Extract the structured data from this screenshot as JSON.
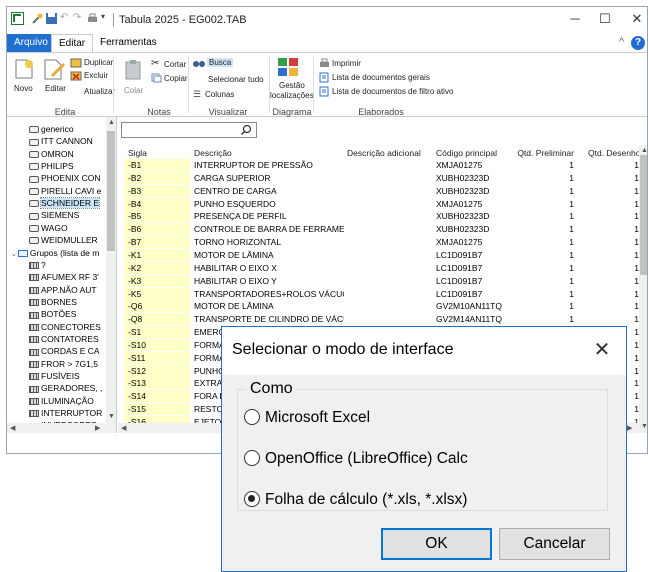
{
  "window": {
    "title": "Tabula 2025 - EG002.TAB",
    "controls": {
      "minimize": "─",
      "maximize": "☐",
      "close": "✕"
    }
  },
  "ribbon_tabs": {
    "file": "Arquivo",
    "edit": "Editar",
    "tools": "Ferramentas",
    "collapse": "^",
    "help": "?"
  },
  "ribbon": {
    "edita": {
      "novo": "Novo",
      "editar": "Editar",
      "duplicar": "Duplicar",
      "excluir": "Excluir",
      "atualizar": "Atualizar",
      "label": "Edita"
    },
    "notas": {
      "colar": "Colar",
      "cortar": "Cortar",
      "copiar": "Copiar",
      "label": "Notas"
    },
    "visualizar": {
      "busca": "Busca",
      "selecionar_tudo": "Selecionar tudo",
      "colunas": "Colunas",
      "label": "Visualizar"
    },
    "diagrama": {
      "gestao": "Gestão",
      "localizacoes": "localizações",
      "label": "Diagrama"
    },
    "elaborados": {
      "imprimir": "Imprimir",
      "lista_geral": "Lista de documentos gerais",
      "lista_filtro": "Lista de documentos de filtro ativo",
      "label": "Elaborados"
    }
  },
  "tree": {
    "items": [
      {
        "label": "generico",
        "kind": "folder"
      },
      {
        "label": "ITT CANNON",
        "kind": "folder"
      },
      {
        "label": "OMRON",
        "kind": "folder"
      },
      {
        "label": "PHILIPS",
        "kind": "folder"
      },
      {
        "label": "PHOENIX CON",
        "kind": "folder"
      },
      {
        "label": "PIRELLI CAVI e",
        "kind": "folder"
      },
      {
        "label": "SCHNEIDER E",
        "kind": "folder",
        "selected": true
      },
      {
        "label": "SIEMENS",
        "kind": "folder"
      },
      {
        "label": "WAGO",
        "kind": "folder"
      },
      {
        "label": "WEIDMULLER",
        "kind": "folder"
      },
      {
        "label": "Grupos (lista de m",
        "kind": "root"
      },
      {
        "label": "?",
        "kind": "group"
      },
      {
        "label": "AFUMEX RF 3'",
        "kind": "group"
      },
      {
        "label": "APP.NÃO AUT",
        "kind": "group"
      },
      {
        "label": "BORNES",
        "kind": "group"
      },
      {
        "label": "BOTÕES",
        "kind": "group"
      },
      {
        "label": "CONECTORES",
        "kind": "group"
      },
      {
        "label": "CONTATORES",
        "kind": "group"
      },
      {
        "label": "CORDAS E CA",
        "kind": "group"
      },
      {
        "label": "FROR > 7G1,5",
        "kind": "group"
      },
      {
        "label": "FUSÍVEIS",
        "kind": "group"
      },
      {
        "label": "GERADORES, ,",
        "kind": "group"
      },
      {
        "label": "ILUMINAÇÃO",
        "kind": "group"
      },
      {
        "label": "INTERRUPTOR",
        "kind": "group"
      },
      {
        "label": "INVERSORES",
        "kind": "group"
      }
    ]
  },
  "grid": {
    "search_placeholder": "",
    "columns": [
      "Sigla",
      "Descrição",
      "Descrição adicional",
      "Código principal",
      "Qtd. Preliminar",
      "Qtd. Desenho"
    ],
    "rows": [
      {
        "sigla": "-B1",
        "desc": "INTERRUPTOR DE PRESSÃO",
        "add": "",
        "code": "XMJA01275",
        "qp": "1",
        "qd": "1"
      },
      {
        "sigla": "-B2",
        "desc": "CARGA SUPERIOR",
        "add": "",
        "code": "XUBH02323D",
        "qp": "1",
        "qd": "1"
      },
      {
        "sigla": "-B3",
        "desc": "CENTRO DE CARGA",
        "add": "",
        "code": "XUBH02323D",
        "qp": "1",
        "qd": "1"
      },
      {
        "sigla": "-B4",
        "desc": "PUNHO ESQUERDO",
        "add": "",
        "code": "XMJA01275",
        "qp": "1",
        "qd": "1"
      },
      {
        "sigla": "-B5",
        "desc": "PRESENÇA DE PERFIL",
        "add": "",
        "code": "XUBH02323D",
        "qp": "1",
        "qd": "1"
      },
      {
        "sigla": "-B6",
        "desc": "CONTROLE DE BARRA DE FERRAMENT...",
        "add": "",
        "code": "XUBH02323D",
        "qp": "1",
        "qd": "1"
      },
      {
        "sigla": "-B7",
        "desc": "TORNO HORIZONTAL",
        "add": "",
        "code": "XMJA01275",
        "qp": "1",
        "qd": "1"
      },
      {
        "sigla": "-K1",
        "desc": "MOTOR DE LÂMINA",
        "add": "",
        "code": "LC1D091B7",
        "qp": "1",
        "qd": "1"
      },
      {
        "sigla": "-K2",
        "desc": "HABILITAR O EIXO X",
        "add": "",
        "code": "LC1D091B7",
        "qp": "1",
        "qd": "1"
      },
      {
        "sigla": "-K3",
        "desc": "HABILITAR O EIXO Y",
        "add": "",
        "code": "LC1D091B7",
        "qp": "1",
        "qd": "1"
      },
      {
        "sigla": "-K5",
        "desc": "TRANSPORTADORES+ROLOS VÁCUO",
        "add": "",
        "code": "LC1D091B7",
        "qp": "1",
        "qd": "1"
      },
      {
        "sigla": "-Q6",
        "desc": "MOTOR DE LÂMINA",
        "add": "",
        "code": "GV2M10AN11TQ",
        "qp": "1",
        "qd": "1"
      },
      {
        "sigla": "-Q8",
        "desc": "TRANSPORTE DE CILINDRO DE VÁCUO",
        "add": "",
        "code": "GV2M14AN11TQ",
        "qp": "1",
        "qd": "1"
      },
      {
        "sigla": "-S1",
        "desc": "EMERGÊNCIA",
        "add": "",
        "code": "",
        "qp": "",
        "qd": "1"
      },
      {
        "sigla": "-S10",
        "desc": "FORMA 1",
        "add": "",
        "code": "",
        "qp": "",
        "qd": "1"
      },
      {
        "sigla": "-S11",
        "desc": "FORMA 2",
        "add": "",
        "code": "",
        "qp": "",
        "qd": "1"
      },
      {
        "sigla": "-S12",
        "desc": "PUNHO E",
        "add": "",
        "code": "",
        "qp": "",
        "qd": "1"
      },
      {
        "sigla": "-S13",
        "desc": "EXTRATO",
        "add": "",
        "code": "",
        "qp": "",
        "qd": "1"
      },
      {
        "sigla": "-S14",
        "desc": "FORA DO",
        "add": "",
        "code": "",
        "qp": "",
        "qd": "1"
      },
      {
        "sigla": "-S15",
        "desc": "RESTO D",
        "add": "",
        "code": "",
        "qp": "",
        "qd": "1"
      },
      {
        "sigla": "-S16",
        "desc": "EJETOR P",
        "add": "",
        "code": "",
        "qp": "",
        "qd": "1"
      }
    ]
  },
  "dialog": {
    "title": "Selecionar o modo de interface",
    "close": "✕",
    "group_label": "Como",
    "options": [
      {
        "label": "Microsoft Excel",
        "checked": false
      },
      {
        "label": "OpenOffice (LibreOffice) Calc",
        "checked": false
      },
      {
        "label": "Folha de cálculo (*.xls, *.xlsx)",
        "checked": true
      }
    ],
    "ok": "OK",
    "cancel": "Cancelar"
  },
  "colors": {
    "accent": "#1f6fd1",
    "sigla_bg": "#ffffc8",
    "selection": "#cce4f7"
  }
}
